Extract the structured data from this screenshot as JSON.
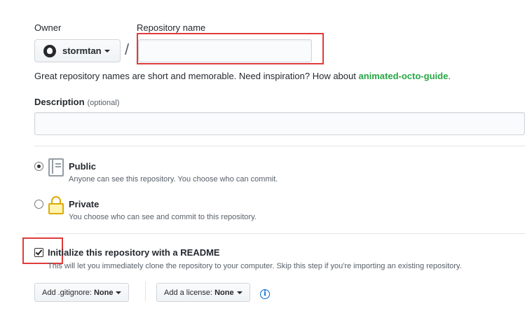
{
  "owner": {
    "label": "Owner",
    "value": "stormtan",
    "icon": "github-mark-icon"
  },
  "separator": "/",
  "repository": {
    "label": "Repository name",
    "value": "",
    "placeholder": ""
  },
  "hint": {
    "text": "Great repository names are short and memorable. Need inspiration? How about ",
    "suggestion": "animated-octo-guide",
    "end": "."
  },
  "description": {
    "label": "Description",
    "optional": "(optional)",
    "value": ""
  },
  "visibility": {
    "options": [
      {
        "title": "Public",
        "description": "Anyone can see this repository. You choose who can commit.",
        "selected": true,
        "icon": "repo-book-icon"
      },
      {
        "title": "Private",
        "description": "You choose who can see and commit to this repository.",
        "selected": false,
        "icon": "lock-icon"
      }
    ]
  },
  "readme": {
    "checked": true,
    "title": "Initialize this repository with a README",
    "description": "This will let you immediately clone the repository to your computer. Skip this step if you're importing an existing repository."
  },
  "gitignore": {
    "label": "Add .gitignore:",
    "value": "None"
  },
  "license": {
    "label": "Add a license:",
    "value": "None"
  },
  "colors": {
    "highlight": "#e03c3c",
    "suggestion": "#28a745",
    "info": "#0366d6"
  }
}
